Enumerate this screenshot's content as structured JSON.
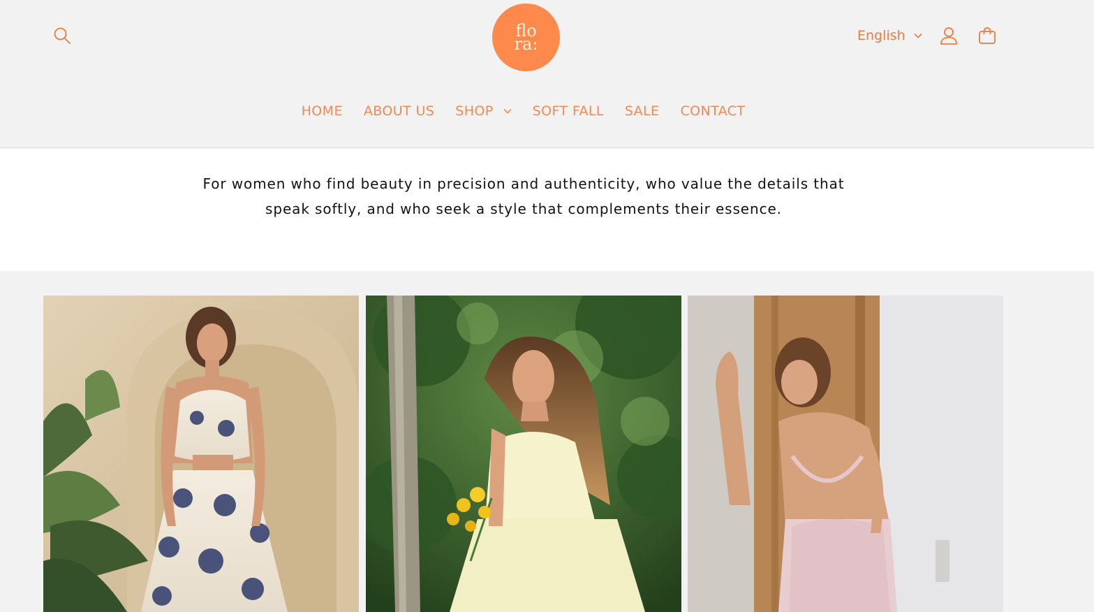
{
  "brand": {
    "logo_line1": "flo",
    "logo_line2": "ra:",
    "accent_color": "#fd8a4c",
    "nav_color": "#ef8a56"
  },
  "header": {
    "search_icon": "search-icon",
    "language": "English",
    "account_icon": "user-icon",
    "cart_icon": "bag-icon"
  },
  "nav": {
    "items": [
      {
        "label": "HOME"
      },
      {
        "label": "ABOUT US"
      },
      {
        "label": "SHOP",
        "has_dropdown": true
      },
      {
        "label": "SOFT FALL"
      },
      {
        "label": "SALE"
      },
      {
        "label": "CONTACT"
      }
    ]
  },
  "intro": {
    "text": "For women who find beauty in precision and authenticity, who value the details that speak softly, and who seek a style that complements their essence."
  },
  "gallery": {
    "images": [
      {
        "name": "paisley-halter-dress-photo"
      },
      {
        "name": "yellow-sundress-photo"
      },
      {
        "name": "blush-backless-dress-photo"
      }
    ]
  }
}
